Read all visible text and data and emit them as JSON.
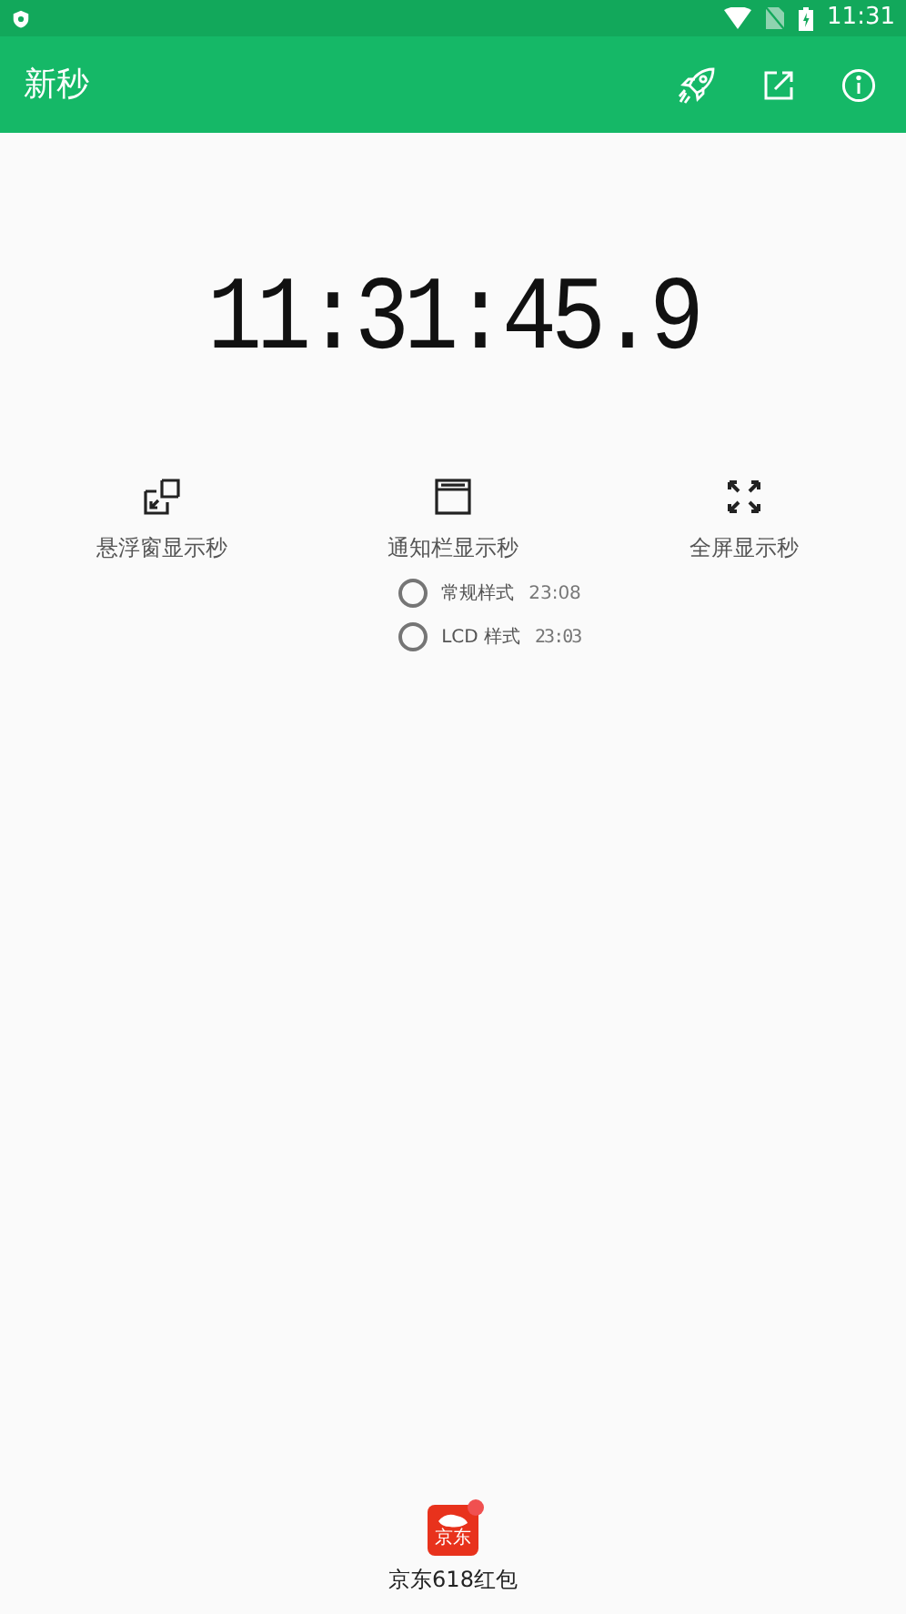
{
  "status_bar": {
    "time": "11:31"
  },
  "app_bar": {
    "title": "新秒"
  },
  "clock": {
    "time": "11:31:45.9"
  },
  "modes": [
    {
      "kind": "float",
      "label": "悬浮窗显示秒"
    },
    {
      "kind": "notification",
      "label": "通知栏显示秒"
    },
    {
      "kind": "fullscreen",
      "label": "全屏显示秒"
    }
  ],
  "styles": [
    {
      "label": "常规样式",
      "sample": "23:08",
      "kind": "normal",
      "selected": false
    },
    {
      "label": "LCD 样式",
      "sample": "23:03",
      "kind": "lcd",
      "selected": false
    }
  ],
  "promo": {
    "icon_text": "京东",
    "label": "京东618红包"
  }
}
